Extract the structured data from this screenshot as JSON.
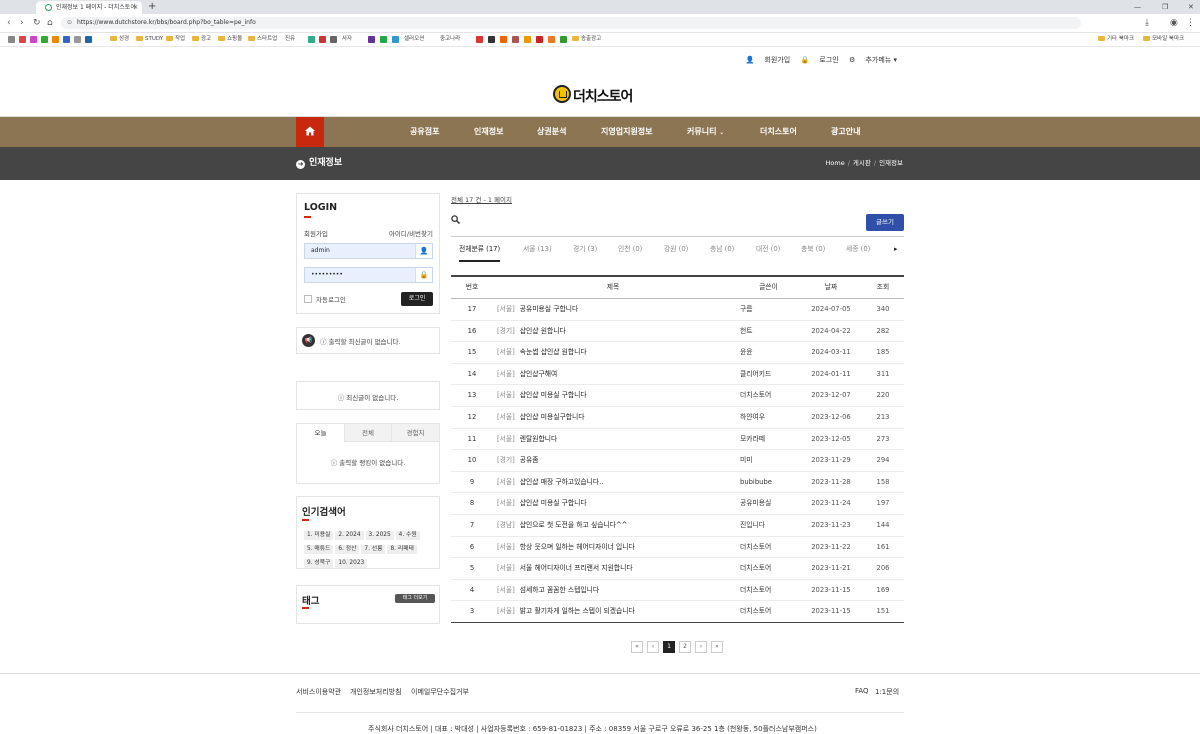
{
  "browser": {
    "tab_title": "인재정보 1 페이지 - 더치스토어",
    "url": "https://www.dutchstore.kr/bbs/board.php?bo_table=pe_info",
    "bookmarks": [
      "성경",
      "STUDY",
      "작업",
      "광고",
      "쇼핑몰",
      "스타트업",
      "진유",
      "사자",
      "셀러오션",
      "중고나라",
      "송출광고"
    ],
    "bookmarks_right": [
      "기타 북마크",
      "모바일 북마크"
    ]
  },
  "header": {
    "menu": [
      "회원가입",
      "로그인",
      "추가메뉴"
    ],
    "logo_text": "더치스토어",
    "nav": [
      "공유점포",
      "인재정보",
      "상권분석",
      "지영업지원정보",
      "커뮤니티",
      "더치스토어",
      "광고안내"
    ]
  },
  "subheader": {
    "title": "인재정보",
    "breadcrumb": [
      "Home",
      "게시판",
      "인재정보"
    ]
  },
  "sidebar": {
    "login_title": "LOGIN",
    "signup": "회원가입",
    "find": "아이디/비번찾기",
    "username": "admin",
    "password": "•••••••••",
    "auto_login": "자동로그인",
    "login_btn": "로그인",
    "notice_empty": "출력할 최신글이 없습니다.",
    "latest_empty": "최신글이 없습니다.",
    "rank_tabs": [
      "오늘",
      "전체",
      "경험치"
    ],
    "rank_empty": "출력할 랭킹이 없습니다.",
    "popular_title": "인기검색어",
    "popular": [
      "1. 미용실",
      "2. 2024",
      "3. 2025",
      "4. 수원",
      "5. 매튜드",
      "6. 정산",
      "7. 선릉",
      "8. 리페테",
      "9. 성북구",
      "10. 2023"
    ],
    "tag_title": "태그",
    "tag_more": "태그 더보기"
  },
  "board": {
    "total": "전체 17 건 - 1 페이지",
    "write_btn": "글쓰기",
    "categories": [
      "전체분류 (17)",
      "서울 (13)",
      "경기 (3)",
      "인천 (0)",
      "강원 (0)",
      "충남 (0)",
      "대전 (0)",
      "충북 (0)",
      "세종 (0)"
    ],
    "columns": [
      "번호",
      "제목",
      "글쓴이",
      "날짜",
      "조회"
    ],
    "rows": [
      {
        "no": "17",
        "cat": "[서울]",
        "subject": "공유미용실 구합니다",
        "author": "구름",
        "date": "2024-07-05",
        "hits": "340"
      },
      {
        "no": "16",
        "cat": "[경기]",
        "subject": "샵인샵 원합니다",
        "author": "헌트",
        "date": "2024-04-22",
        "hits": "282"
      },
      {
        "no": "15",
        "cat": "[서울]",
        "subject": "속눈썹 샵인샵 원합니다",
        "author": "윤윤",
        "date": "2024-03-11",
        "hits": "185"
      },
      {
        "no": "14",
        "cat": "[서울]",
        "subject": "샵인샵구해여",
        "author": "클리어키드",
        "date": "2024-01-11",
        "hits": "311"
      },
      {
        "no": "13",
        "cat": "[서울]",
        "subject": "샵인샵 미용실 구합니다",
        "author": "더치스토어",
        "date": "2023-12-07",
        "hits": "220"
      },
      {
        "no": "12",
        "cat": "[서울]",
        "subject": "샵인샵 미용실구합니다",
        "author": "하얀여우",
        "date": "2023-12-06",
        "hits": "213"
      },
      {
        "no": "11",
        "cat": "[서울]",
        "subject": "렌탈원합니다",
        "author": "모카라떼",
        "date": "2023-12-05",
        "hits": "273"
      },
      {
        "no": "10",
        "cat": "[경기]",
        "subject": "공유좀",
        "author": "미미",
        "date": "2023-11-29",
        "hits": "294"
      },
      {
        "no": "9",
        "cat": "[서울]",
        "subject": "샵인샵 매장 구하고있습니다..",
        "author": "bubibube",
        "date": "2023-11-28",
        "hits": "158"
      },
      {
        "no": "8",
        "cat": "[서울]",
        "subject": "샵인샵 미용실 구합니다",
        "author": "공유미용실",
        "date": "2023-11-24",
        "hits": "197"
      },
      {
        "no": "7",
        "cat": "[경남]",
        "subject": "샵인으로 첫 도전을 하고 싶습니다^^",
        "author": "진입니다",
        "date": "2023-11-23",
        "hits": "144"
      },
      {
        "no": "6",
        "cat": "[서울]",
        "subject": "항상 웃으며 일하는 헤어디자이너 입니다",
        "author": "더치스토어",
        "date": "2023-11-22",
        "hits": "161"
      },
      {
        "no": "5",
        "cat": "[서울]",
        "subject": "서울 헤어디자이너 프리랜서 지원합니다",
        "author": "더치스토어",
        "date": "2023-11-21",
        "hits": "206"
      },
      {
        "no": "4",
        "cat": "[서울]",
        "subject": "섬세하고 꼼꼼한 스텝입니다",
        "author": "더치스토어",
        "date": "2023-11-15",
        "hits": "169"
      },
      {
        "no": "3",
        "cat": "[서울]",
        "subject": "밝고 활기차게 일하는 스텝이 되겠습니다",
        "author": "더치스토어",
        "date": "2023-11-15",
        "hits": "151"
      }
    ],
    "pagination": [
      "«",
      "‹",
      "1",
      "2",
      "›",
      "»"
    ]
  },
  "footer": {
    "links": [
      "서비스이용약관",
      "개인정보처리방침",
      "이메일무단수집거부"
    ],
    "right_links": [
      "FAQ",
      "1:1문의"
    ],
    "company": "주식회사 더치스토어 | 대표 : 박대성 | 사업자등록번호 : 659-81-01823 | 주소 : 08359 서울 구로구 오류로 36-25 1층 (천왕동, 50플러스남부캠퍼스)"
  },
  "colors": {
    "accent": "#c8290e",
    "nav": "#8b7553",
    "subbar": "#454545",
    "write": "#2f4fa8"
  }
}
